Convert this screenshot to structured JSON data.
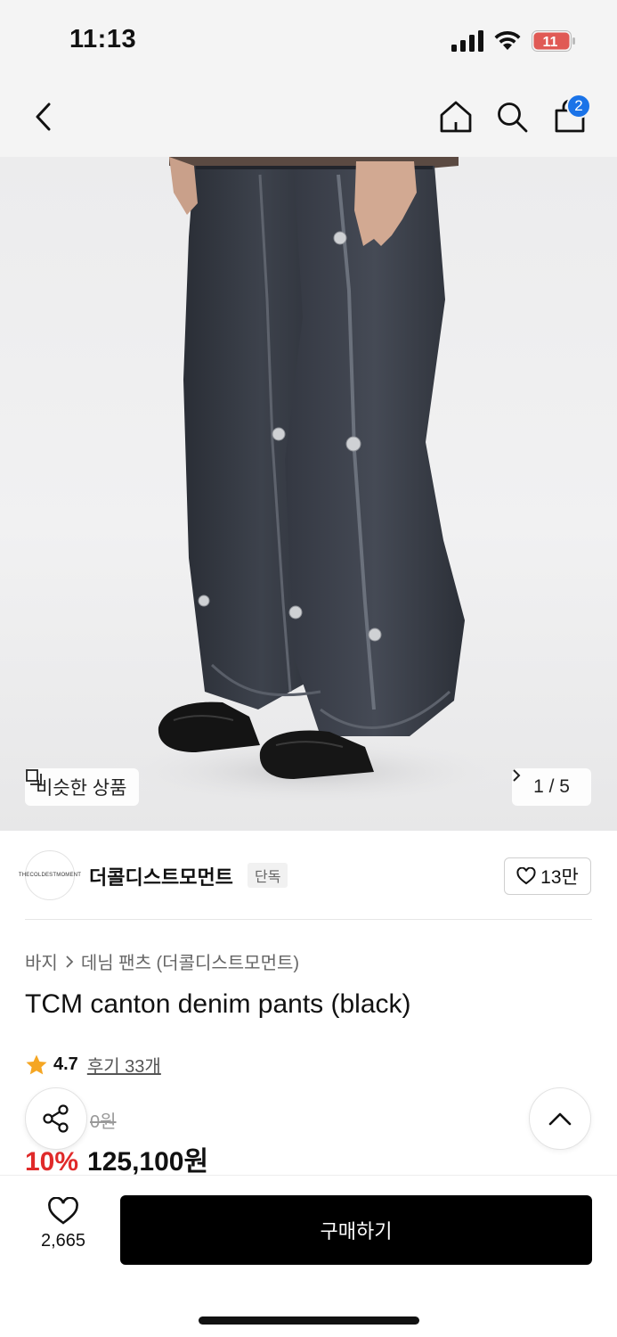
{
  "status_bar": {
    "time": "11:13",
    "battery": "11"
  },
  "nav": {
    "cart_count": "2",
    "icons": [
      "back-icon",
      "home-icon",
      "search-icon",
      "cart-icon"
    ]
  },
  "hero": {
    "similar_label": "비슷한 상품",
    "page_indicator": "1 / 5"
  },
  "brand": {
    "logo_text": "THECOLDESTMOMENT",
    "name": "더콜디스트모먼트",
    "tag": "단독",
    "likes": "13만"
  },
  "product": {
    "breadcrumb": [
      "바지",
      "데님 팬츠 (더콜디스트모먼트)"
    ],
    "title": "TCM canton denim pants (black)",
    "rating": "4.7",
    "reviews": "후기 33개",
    "original_price": "0원",
    "discount": "10%",
    "sale_price": "125,100원"
  },
  "bottom": {
    "wish_count": "2,665",
    "buy_label": "구매하기"
  },
  "colors": {
    "accent_blue": "#1a73e8",
    "discount_red": "#e02a2a",
    "star": "#f5a623",
    "buy_button": "#000000"
  }
}
